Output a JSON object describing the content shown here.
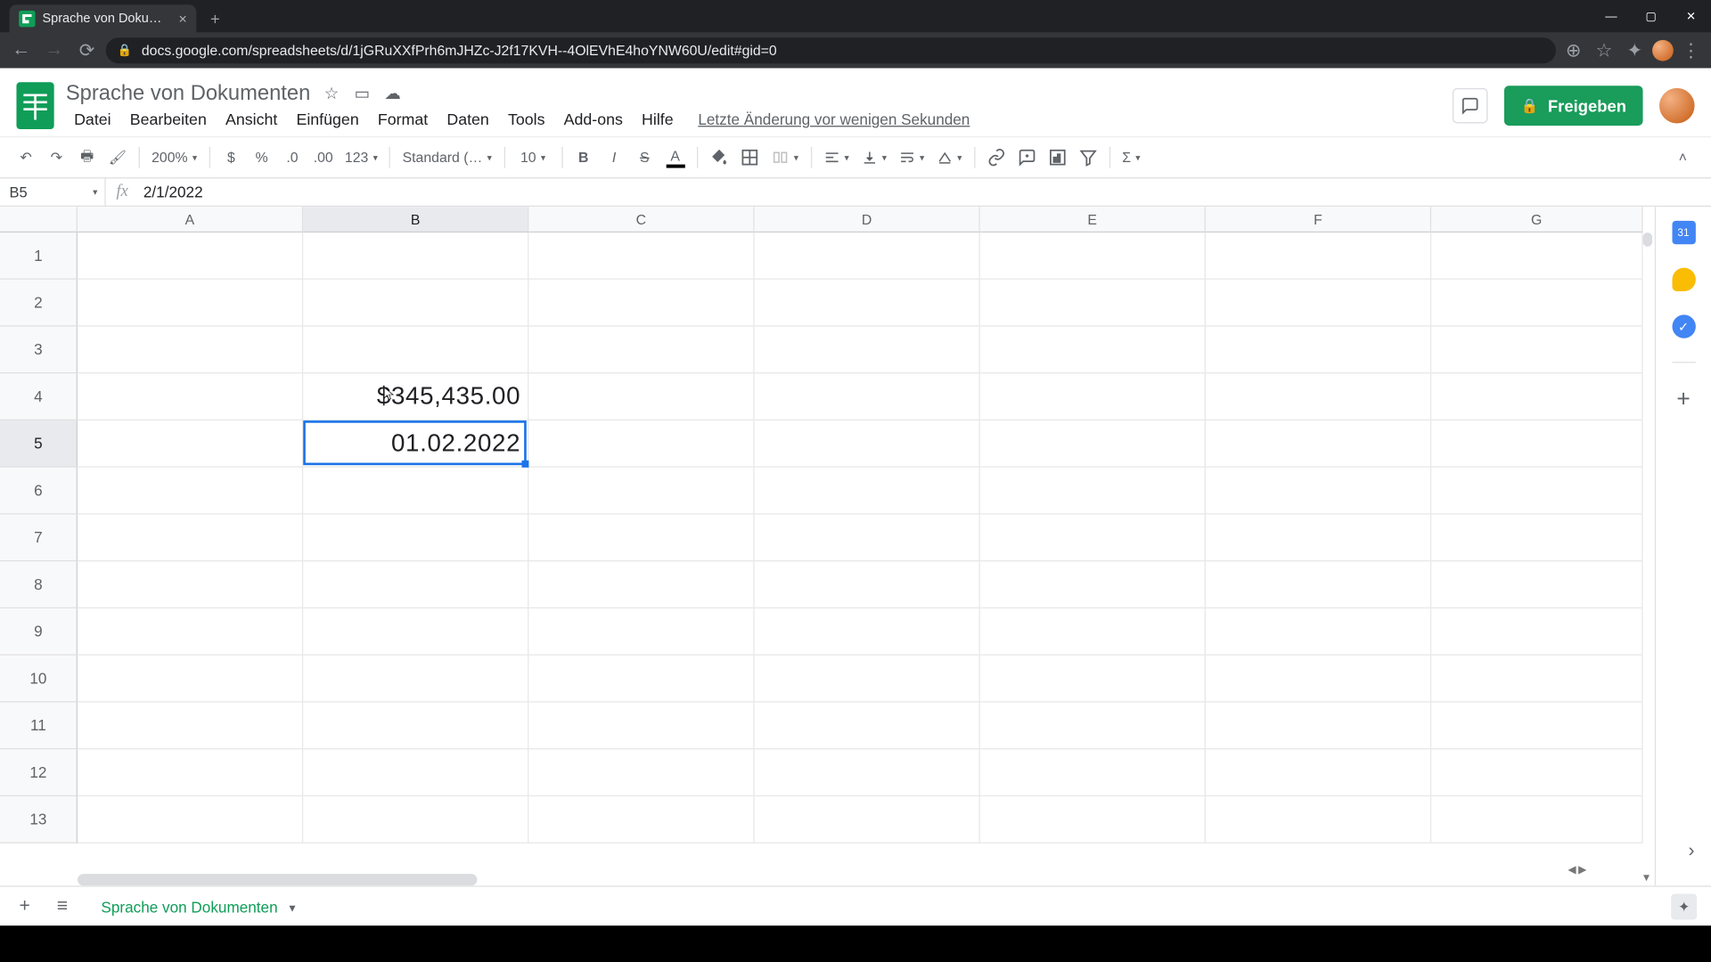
{
  "browser": {
    "tab_title": "Sprache von Dokumenten - Goo…",
    "url": "docs.google.com/spreadsheets/d/1jGRuXXfPrh6mJHZc-J2f17KVH--4OlEVhE4hoYNW60U/edit#gid=0"
  },
  "doc": {
    "title": "Sprache von Dokumenten",
    "last_edit": "Letzte Änderung vor wenigen Sekunden"
  },
  "menu": {
    "file": "Datei",
    "edit": "Bearbeiten",
    "view": "Ansicht",
    "insert": "Einfügen",
    "format": "Format",
    "data": "Daten",
    "tools": "Tools",
    "addons": "Add-ons",
    "help": "Hilfe"
  },
  "share": {
    "label": "Freigeben"
  },
  "toolbar": {
    "zoom": "200%",
    "currency": "$",
    "percent": "%",
    "dec_dec": ".0",
    "inc_dec": ".00",
    "num_format": "123",
    "font": "Standard (…",
    "font_size": "10",
    "sigma": "Σ"
  },
  "namebox": "B5",
  "formula": "2/1/2022",
  "columns": {
    "A": "A",
    "B": "B",
    "C": "C",
    "D": "D",
    "E": "E",
    "F": "F",
    "G": "G"
  },
  "rows": [
    "1",
    "2",
    "3",
    "4",
    "5",
    "6",
    "7",
    "8",
    "9",
    "10",
    "11",
    "12",
    "13"
  ],
  "cells": {
    "B4": "$345,435.00",
    "B5": "01.02.2022"
  },
  "sheet_tab": "Sprache von Dokumenten",
  "selection": {
    "cell": "B5"
  }
}
